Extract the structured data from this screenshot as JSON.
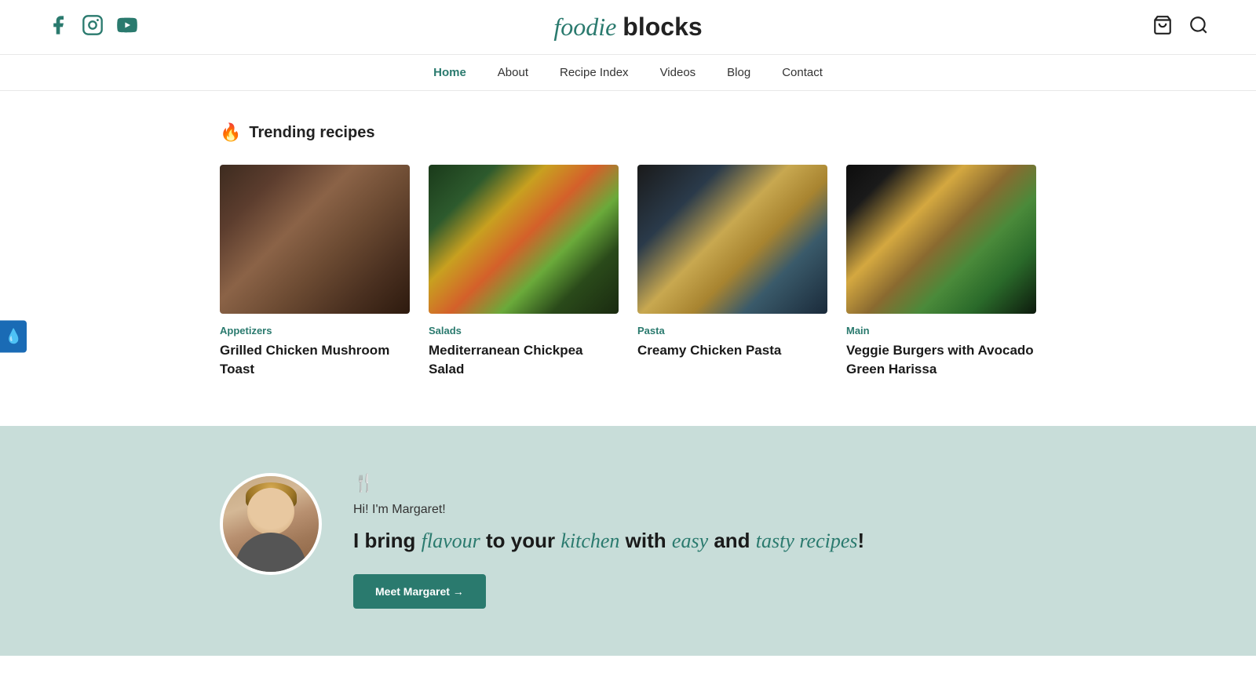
{
  "site": {
    "logo_foodie": "foodie",
    "logo_blocks": "blocks"
  },
  "social": {
    "facebook_label": "Facebook",
    "instagram_label": "Instagram",
    "youtube_label": "YouTube"
  },
  "nav": {
    "items": [
      {
        "label": "Home",
        "active": true
      },
      {
        "label": "About",
        "active": false
      },
      {
        "label": "Recipe Index",
        "active": false
      },
      {
        "label": "Videos",
        "active": false
      },
      {
        "label": "Blog",
        "active": false
      },
      {
        "label": "Contact",
        "active": false
      }
    ]
  },
  "trending": {
    "heading": "Trending recipes",
    "recipes": [
      {
        "category": "Appetizers",
        "title": "Grilled Chicken Mushroom Toast",
        "img_class": "img-toast"
      },
      {
        "category": "Salads",
        "title": "Mediterranean Chickpea Salad",
        "img_class": "img-salad"
      },
      {
        "category": "Pasta",
        "title": "Creamy Chicken Pasta",
        "img_class": "img-pasta"
      },
      {
        "category": "Main",
        "title": "Veggie Burgers with Avocado Green Harissa",
        "img_class": "img-burger"
      }
    ]
  },
  "about": {
    "greeting": "Hi! I'm Margaret!",
    "tagline_plain1": "I bring",
    "tagline_italic1": "flavour",
    "tagline_plain2": "to your",
    "tagline_italic2": "kitchen",
    "tagline_plain3": "with",
    "tagline_italic3": "easy",
    "tagline_plain4": "and",
    "tagline_italic4": "tasty recipes",
    "tagline_end": "!",
    "button_label": "Meet Margaret →"
  },
  "side_widget": {
    "icon": "💧"
  },
  "colors": {
    "teal": "#2a7a6e",
    "light_teal_bg": "#c8ddd9"
  }
}
